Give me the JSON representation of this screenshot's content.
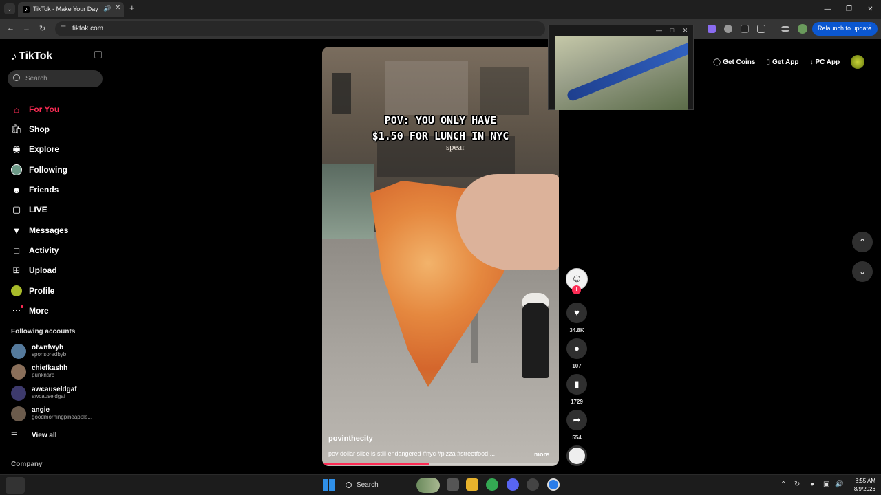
{
  "browser": {
    "tab_title": "TikTok - Make Your Day",
    "url": "tiktok.com",
    "relaunch_label": "Relaunch to update"
  },
  "sidebar": {
    "logo_text": "TikTok",
    "search_placeholder": "Search",
    "nav": [
      {
        "label": "For You",
        "icon": "home-icon",
        "active": true
      },
      {
        "label": "Shop",
        "icon": "shopping-bag-icon"
      },
      {
        "label": "Explore",
        "icon": "compass-icon"
      },
      {
        "label": "Following",
        "icon": "following-avatar-icon"
      },
      {
        "label": "Friends",
        "icon": "friends-icon"
      },
      {
        "label": "LIVE",
        "icon": "live-icon"
      },
      {
        "label": "Messages",
        "icon": "paper-plane-icon"
      },
      {
        "label": "Activity",
        "icon": "activity-inbox-icon"
      },
      {
        "label": "Upload",
        "icon": "upload-plus-icon"
      },
      {
        "label": "Profile",
        "icon": "profile-avatar-icon"
      },
      {
        "label": "More",
        "icon": "more-dots-icon"
      }
    ],
    "following_title": "Following accounts",
    "following": [
      {
        "name": "otwnfwyb",
        "sub": "sponsoredbyb"
      },
      {
        "name": "chiefkashh",
        "sub": "punknarc"
      },
      {
        "name": "awcauseldgaf",
        "sub": "awcauseldgaf"
      },
      {
        "name": "angie",
        "sub": "goodmorningpineapple..."
      }
    ],
    "view_all": "View all",
    "company": "Company"
  },
  "video": {
    "overlay_line1": "POV: YOU ONLY HAVE",
    "overlay_line2": "$1.50 FOR LUNCH IN NYC",
    "storefront_sign": "spear",
    "author": "povinthecity",
    "caption": "pov dollar slice is still endangered #nyc #pizza #streetfood ...",
    "more": "more",
    "progress": 0.45
  },
  "actions": {
    "likes": "34.8K",
    "comments": "107",
    "saves": "1729",
    "shares": "554"
  },
  "topbar": {
    "get_coins": "Get Coins",
    "get_app": "Get App",
    "pc_app": "PC App"
  },
  "taskbar": {
    "search": "Search",
    "time": "8:55 AM",
    "date": "8/9/2026"
  },
  "colors": {
    "accent": "#fe2c55",
    "chrome_blue": "#0b57d0"
  }
}
